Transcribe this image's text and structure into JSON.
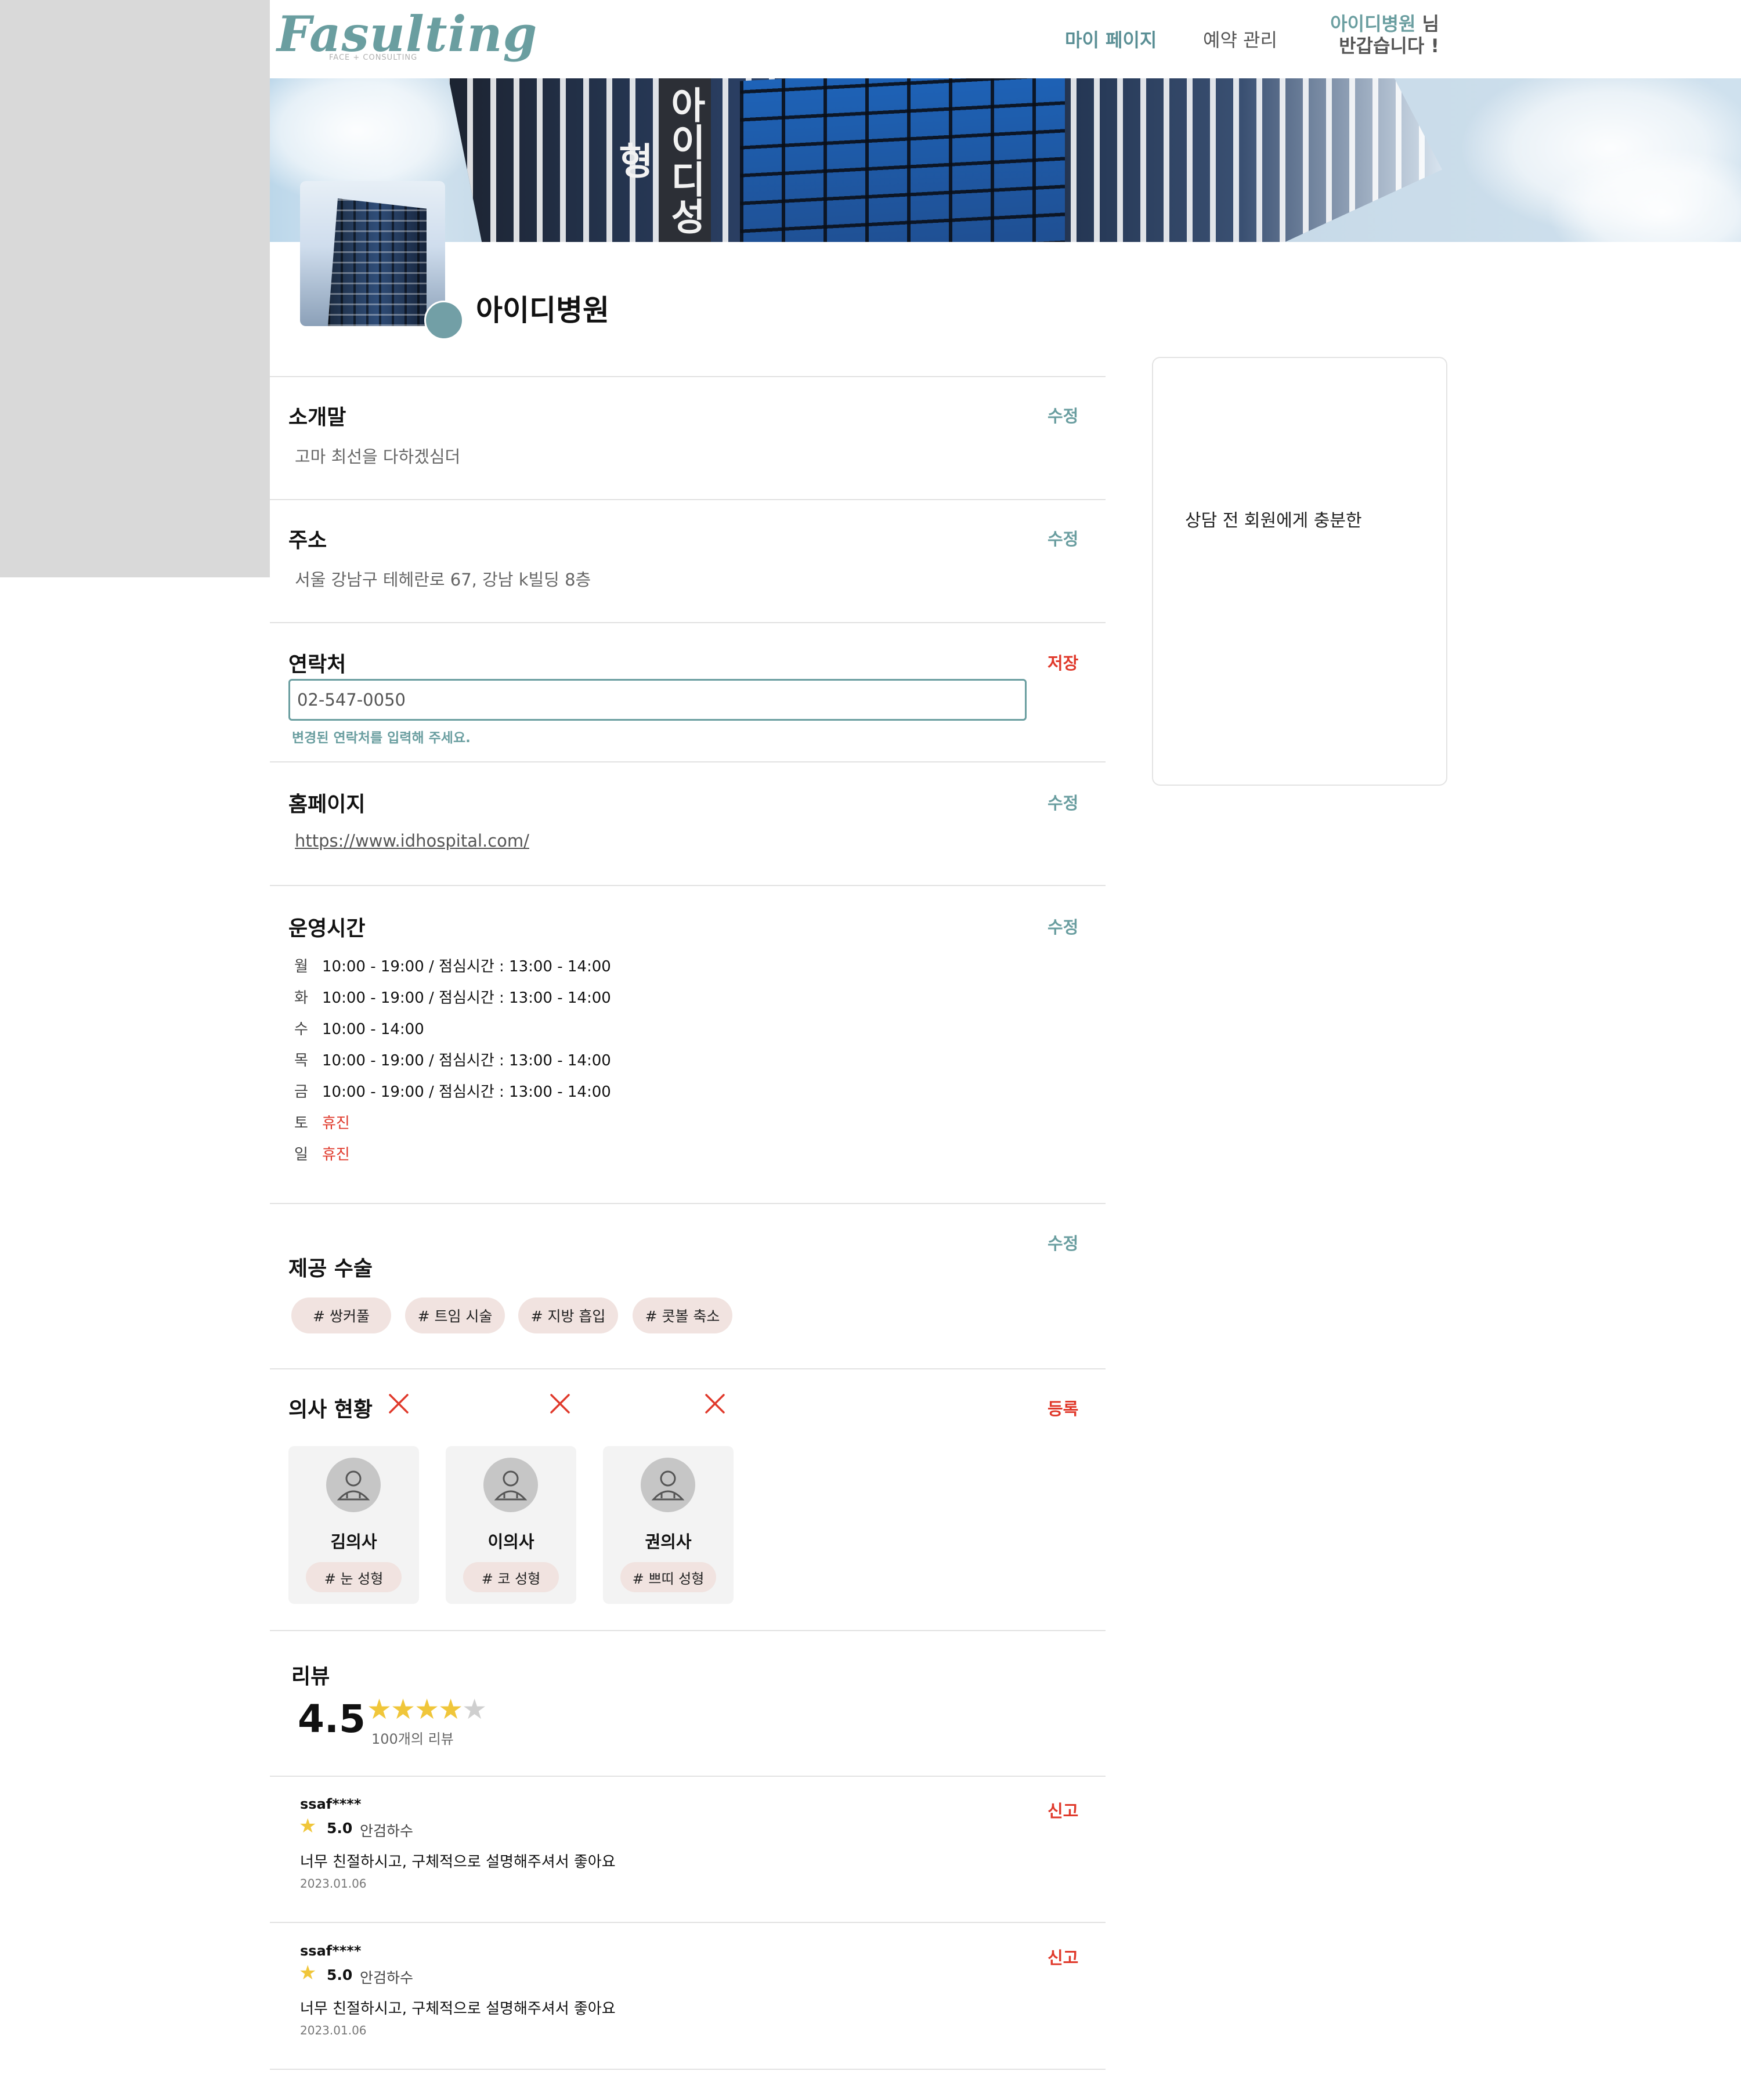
{
  "header": {
    "logo": "Fasulting",
    "logo_sub": "FACE + CONSULTING",
    "nav": {
      "mypage": "마이 페이지",
      "reservation": "예약 관리"
    },
    "greeting": {
      "name": "아이디병원",
      "suffix": "님",
      "line2": "반갑습니다 !"
    }
  },
  "banner": {
    "sign_text": "아이디성형"
  },
  "profile": {
    "hospital_name": "아이디병원"
  },
  "side_card": {
    "text": "상담 전 회원에게 충분한"
  },
  "sections": {
    "intro": {
      "title": "소개말",
      "action": "수정",
      "value": "고마 최선을 다하겠심더"
    },
    "address": {
      "title": "주소",
      "action": "수정",
      "value": "서울 강남구 테헤란로 67, 강남 k빌딩 8층"
    },
    "contact": {
      "title": "연락처",
      "action": "저장",
      "input_value": "02-547-0050",
      "hint": "변경된 연락처를 입력해 주세요."
    },
    "homepage": {
      "title": "홈페이지",
      "action": "수정",
      "value": "https://www.idhospital.com/"
    },
    "hours": {
      "title": "운영시간",
      "action": "수정",
      "rows": [
        {
          "day": "월",
          "time": "10:00 - 19:00 / 점심시간 : 13:00 - 14:00"
        },
        {
          "day": "화",
          "time": "10:00 - 19:00 / 점심시간 : 13:00 - 14:00"
        },
        {
          "day": "수",
          "time": "10:00 - 14:00"
        },
        {
          "day": "목",
          "time": "10:00 - 19:00 / 점심시간 : 13:00 - 14:00"
        },
        {
          "day": "금",
          "time": "10:00 - 19:00 / 점심시간 : 13:00 - 14:00"
        },
        {
          "day": "토",
          "time": "휴진",
          "closed": true
        },
        {
          "day": "일",
          "time": "휴진",
          "closed": true
        }
      ]
    },
    "surgeries": {
      "title": "제공 수술",
      "action": "수정",
      "tags": [
        "# 쌍커풀",
        "# 트임 시술",
        "# 지방 흡입",
        "# 콧볼 축소"
      ]
    },
    "doctors": {
      "title": "의사 현황",
      "action": "등록",
      "list": [
        {
          "name": "김의사",
          "tag": "# 눈 성형"
        },
        {
          "name": "이의사",
          "tag": "# 코 성형"
        },
        {
          "name": "권의사",
          "tag": "# 쁘띠 성형"
        }
      ]
    },
    "reviews": {
      "title": "리뷰",
      "rating": "4.5",
      "rating_value": 4.5,
      "stars_total": 5,
      "count": "100개의 리뷰",
      "items": [
        {
          "user": "ssaf****",
          "score": "5.0",
          "doctor": "안검하수",
          "text": "너무 친절하시고, 구체적으로 설명해주셔서 좋아요",
          "date": "2023.01.06",
          "action": "신고"
        },
        {
          "user": "ssaf****",
          "score": "5.0",
          "doctor": "안검하수",
          "text": "너무 친절하시고, 구체적으로 설명해주셔서 좋아요",
          "date": "2023.01.06",
          "action": "신고"
        }
      ]
    }
  },
  "colors": {
    "accent": "#6a9ea0",
    "danger": "#e0392b",
    "tag_bg": "#f1e3e0",
    "star": "#f0c63a"
  },
  "icons": {
    "delete": "close-x-icon",
    "doctor_avatar": "doctor-avatar-icon",
    "star": "star-icon"
  }
}
